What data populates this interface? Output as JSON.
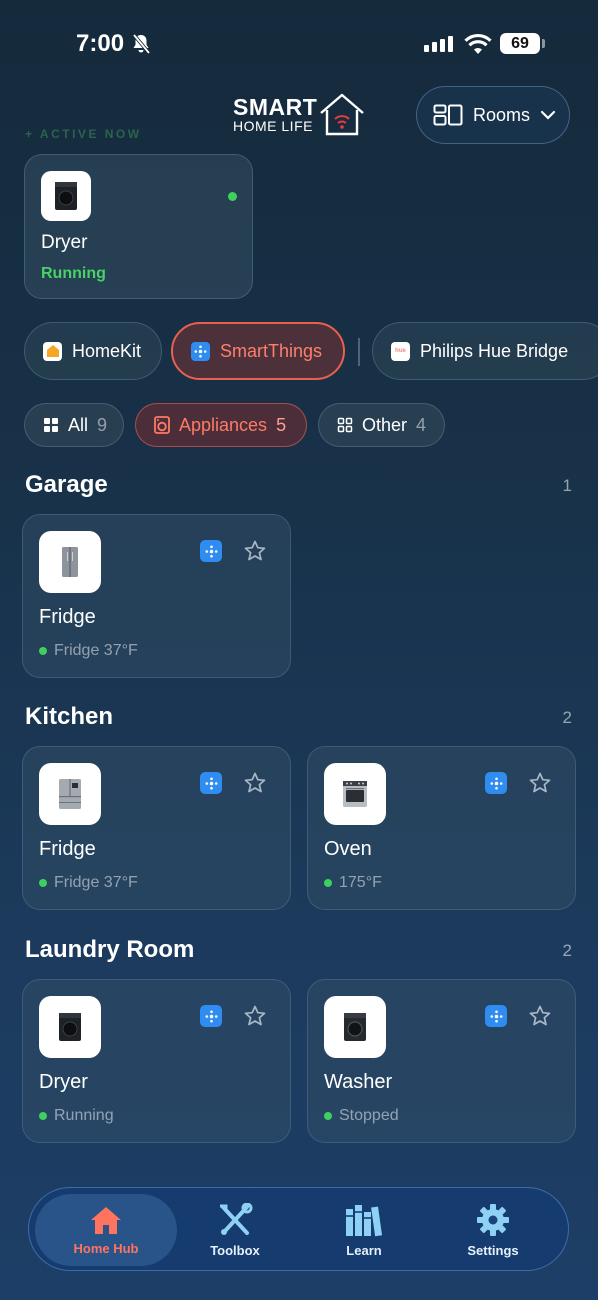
{
  "status_bar": {
    "time": "7:00",
    "battery": "69"
  },
  "app": {
    "logo_line1": "SMART",
    "logo_line2": "HOME LIFE",
    "rooms_button": "Rooms"
  },
  "active_now": {
    "label": "ACTIVE NOW",
    "device": {
      "name": "Dryer",
      "status": "Running"
    }
  },
  "sources": [
    {
      "label": "HomeKit"
    },
    {
      "label": "SmartThings",
      "selected": true
    },
    {
      "label": "Philips Hue Bridge"
    }
  ],
  "filters": [
    {
      "label": "All",
      "count": "9"
    },
    {
      "label": "Appliances",
      "count": "5",
      "selected": true
    },
    {
      "label": "Other",
      "count": "4"
    }
  ],
  "sections": [
    {
      "title": "Garage",
      "count": "1",
      "devices": [
        {
          "name": "Fridge",
          "status": "Fridge 37°F"
        }
      ]
    },
    {
      "title": "Kitchen",
      "count": "2",
      "devices": [
        {
          "name": "Fridge",
          "status": "Fridge 37°F"
        },
        {
          "name": "Oven",
          "status": "175°F"
        }
      ]
    },
    {
      "title": "Laundry Room",
      "count": "2",
      "devices": [
        {
          "name": "Dryer",
          "status": "Running"
        },
        {
          "name": "Washer",
          "status": "Stopped"
        }
      ]
    }
  ],
  "tabs": [
    {
      "label": "Home Hub",
      "icon": "house-icon",
      "selected": true
    },
    {
      "label": "Toolbox",
      "icon": "tools-icon"
    },
    {
      "label": "Learn",
      "icon": "books-icon"
    },
    {
      "label": "Settings",
      "icon": "gear-icon"
    }
  ],
  "colors": {
    "accent": "#ff7460",
    "running": "#48d167",
    "smartthings": "#2f8cf0"
  }
}
